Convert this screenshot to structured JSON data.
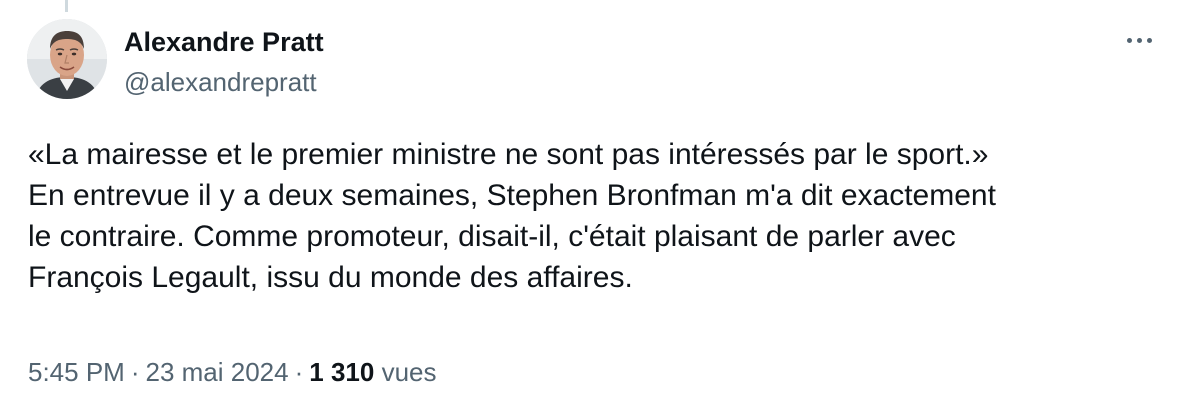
{
  "author": {
    "name": "Alexandre Pratt",
    "handle": "@alexandrepratt",
    "avatar_icon": "profile-photo"
  },
  "menu": {
    "more_icon": "more-horizontal-icon"
  },
  "tweet": {
    "lines": [
      "«La mairesse et le premier ministre ne sont pas intéressés par le sport.»",
      "En entrevue il y a deux semaines, Stephen Bronfman m'a dit exactement",
      "le contraire. Comme promoteur, disait-il, c'était plaisant de parler avec",
      "François Legault, issu du monde des affaires."
    ]
  },
  "meta": {
    "time": "5:45 PM",
    "separator": "·",
    "date": "23 mai 2024",
    "views_count": "1 310",
    "views_label": "vues"
  },
  "colors": {
    "text_primary": "#0f1419",
    "text_secondary": "#536471",
    "thread_line": "#cfd9de",
    "background": "#ffffff"
  }
}
